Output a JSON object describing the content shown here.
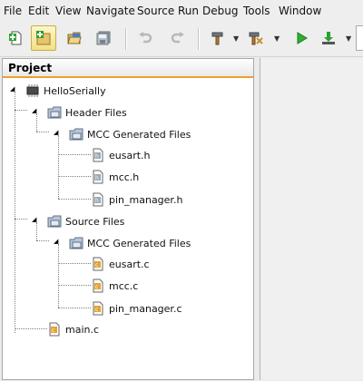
{
  "menubar": {
    "items": [
      "File",
      "Edit",
      "View",
      "Navigate",
      "Source",
      "Run",
      "Debug",
      "Tools",
      "Window"
    ]
  },
  "toolbar": {
    "buttons": [
      "new-file",
      "new-project",
      "open-project",
      "save-all",
      "undo",
      "redo",
      "build",
      "clean-build",
      "run",
      "download"
    ]
  },
  "project_panel": {
    "title": "Project",
    "tree": {
      "root": "HelloSerially",
      "header_files": "Header Files",
      "header_mcc": "MCC Generated Files",
      "header_items": [
        "eusart.h",
        "mcc.h",
        "pin_manager.h"
      ],
      "source_files": "Source Files",
      "source_mcc": "MCC Generated Files",
      "source_items": [
        "eusart.c",
        "mcc.c",
        "pin_manager.c"
      ],
      "main": "main.c"
    }
  },
  "colors": {
    "tab_accent": "#f0a12c",
    "selected_toolbar": "#f2df84"
  }
}
